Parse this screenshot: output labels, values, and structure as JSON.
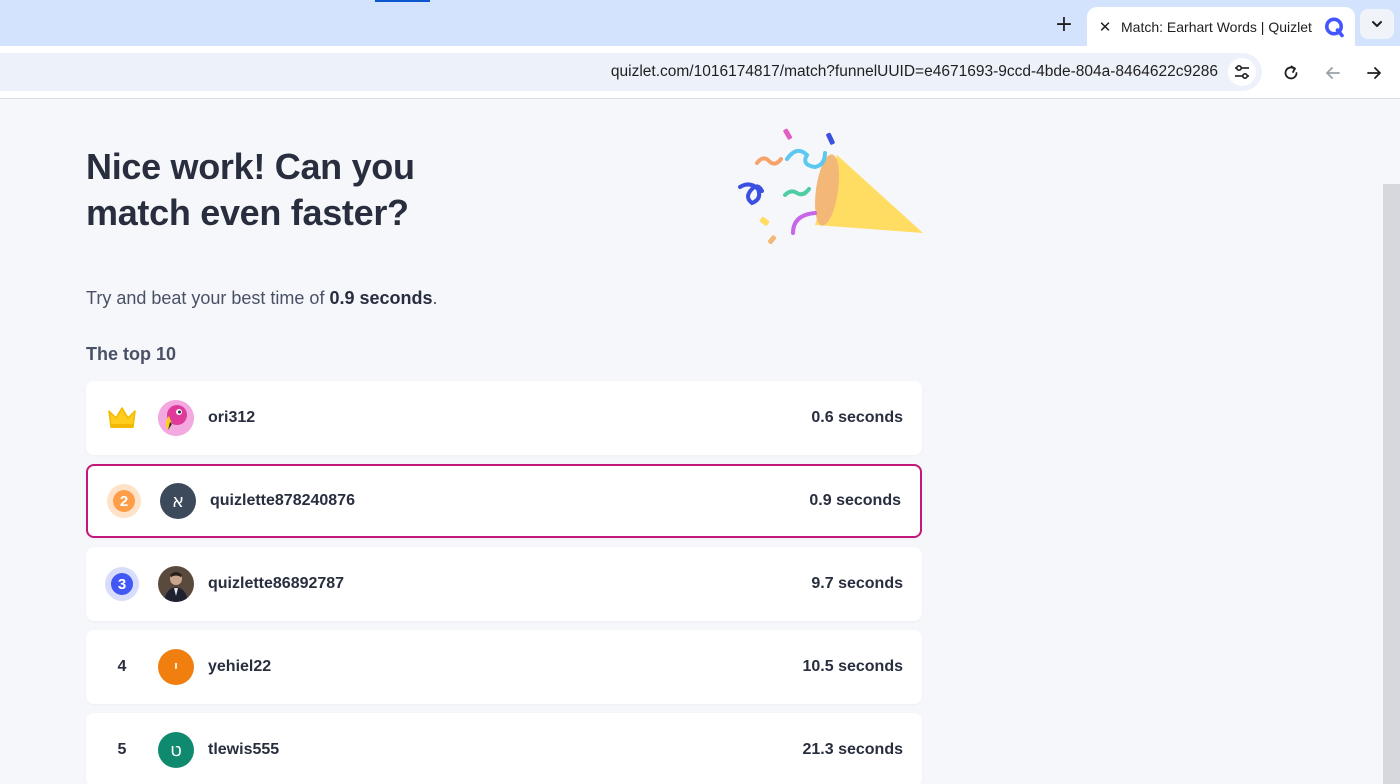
{
  "browser": {
    "tab_title": "Match: Earhart Words | Quizlet",
    "url": "quizlet.com/1016174817/match?funnelUUID=e4671693-9ccd-4bde-804a-8464622c9286",
    "new_tab_icon": "plus-icon",
    "close_icon": "close-icon",
    "favicon": "quizlet-logo-icon",
    "tab_search_icon": "chevron-down-icon",
    "site_settings_icon": "tune-icon",
    "reload_icon": "reload-icon",
    "back_icon": "arrow-left-icon",
    "forward_icon": "arrow-right-icon"
  },
  "result": {
    "headline": "Nice work! Can you match even faster?",
    "subtext_prefix": "Try and beat your best time of ",
    "best_time": "0.9 seconds",
    "subtext_suffix": ".",
    "illustration": "party-popper-icon"
  },
  "leaderboard": {
    "heading": "The top 10",
    "entries": [
      {
        "rank": "1",
        "badge": "crown-icon",
        "username": "ori312",
        "time": "0.6 seconds",
        "avatar": "flamingo-avatar"
      },
      {
        "rank": "2",
        "badge": "medal-2",
        "username": "quizlette878240876",
        "time": "0.9 seconds",
        "avatar": "א",
        "current_user": true
      },
      {
        "rank": "3",
        "badge": "medal-3",
        "username": "quizlette86892787",
        "time": "9.7 seconds",
        "avatar": "photo-avatar"
      },
      {
        "rank": "4",
        "badge": "",
        "username": "yehiel22",
        "time": "10.5 seconds",
        "avatar": "י"
      },
      {
        "rank": "5",
        "badge": "",
        "username": "tlewis555",
        "time": "21.3 seconds",
        "avatar": "ט"
      }
    ]
  },
  "colors": {
    "page_bg": "#f6f7fb",
    "highlight_border": "#c2187a",
    "medal_2": "#ff9e48",
    "medal_3": "#4257f5",
    "avatar_dark": "#3d4a5c",
    "avatar_orange": "#f07f0f",
    "avatar_teal": "#0f8a6e"
  }
}
